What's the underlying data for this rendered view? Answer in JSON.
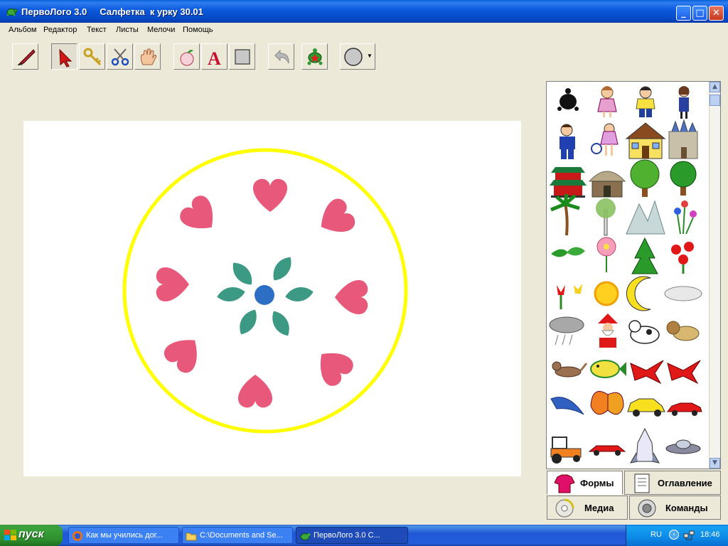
{
  "window": {
    "title": "ПервоЛого 3.0     Салфетка  к урку 30.01",
    "icon": "turtle-icon"
  },
  "menu": [
    "Альбом",
    "Редактор",
    "Текст",
    "Листы",
    "Мелочи",
    "Помощь"
  ],
  "toolbar": {
    "tools": [
      "brush-tool-icon",
      "arrow-select-icon",
      "key-tool-icon",
      "scissors-icon",
      "hand-icon",
      "apple-icon",
      "text-a-icon",
      "rectangle-icon",
      "undo-arrow-icon",
      "turtle-new-icon",
      "circle-shape-picker-icon"
    ]
  },
  "canvas": {
    "ring_color": "#ffff00",
    "heart_color": "#e8587a",
    "leaf_color": "#3c9a84",
    "center_dot_color": "#2e6fc6"
  },
  "shapes_panel": {
    "items": [
      "turtle-icon",
      "girl-icon",
      "boy-icon",
      "schoolgirl-icon",
      "schoolboy-icon",
      "tennis-girl-icon",
      "house-icon",
      "castle-icon",
      "pagoda-icon",
      "hut-icon",
      "tree-icon",
      "tree-icon",
      "palm-tree-icon",
      "birch-tree-icon",
      "mountains-icon",
      "flowers-icon",
      "leaves-icon",
      "pink-flower-icon",
      "fir-tree-icon",
      "red-flowers-icon",
      "tulip-icon",
      "sun-icon",
      "moon-icon",
      "cloud-icon",
      "rain-cloud-icon",
      "santa-icon",
      "dog-icon",
      "lion-icon",
      "cat-icon",
      "fish-icon",
      "red-bird-icon",
      "red-bird-icon",
      "dolphin-icon",
      "butterfly-icon",
      "yellow-car-icon",
      "red-car-icon",
      "tractor-icon",
      "red-sports-car-icon",
      "space-shuttle-icon",
      "ufo-icon"
    ]
  },
  "tabs": {
    "forms": "Формы",
    "contents": "Оглавление",
    "media": "Медиа",
    "commands": "Команды"
  },
  "taskbar": {
    "start_label": "пуск",
    "tasks": [
      {
        "label": "Как мы учились дог...",
        "icon": "firefox-icon"
      },
      {
        "label": "C:\\Documents and Se...",
        "icon": "folder-icon"
      },
      {
        "label": "ПервоЛого 3.0     С...",
        "icon": "turtle-icon"
      }
    ],
    "language": "RU",
    "clock": "18:46"
  }
}
